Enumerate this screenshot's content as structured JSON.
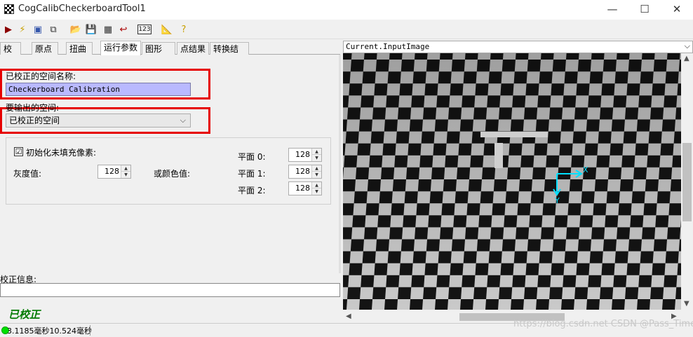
{
  "window": {
    "title": "CogCalibCheckerboardTool1",
    "minimize": "—",
    "maximize": "☐",
    "close": "✕"
  },
  "toolbar": {
    "items": [
      {
        "name": "run-icon",
        "glyph": "▶",
        "color": "#8b0000"
      },
      {
        "name": "electric-icon",
        "glyph": "⚡",
        "color": "#c8a000"
      },
      {
        "name": "display-icon",
        "glyph": "▣",
        "color": "#3355aa"
      },
      {
        "name": "image-source-icon",
        "glyph": "⧉",
        "color": "#333333"
      },
      {
        "name": "open-folder-icon",
        "glyph": "📂",
        "color": "#c8a000"
      },
      {
        "name": "save-icon",
        "glyph": "💾",
        "color": "#222222"
      },
      {
        "name": "grid-icon",
        "glyph": "▦",
        "color": "#333333"
      },
      {
        "name": "reset-icon",
        "glyph": "↩",
        "color": "#aa0000"
      },
      {
        "name": "numeric-icon",
        "glyph": "123",
        "color": "#222222"
      },
      {
        "name": "measure-icon",
        "glyph": "📐",
        "color": "#886600"
      },
      {
        "name": "help-icon",
        "glyph": "?",
        "color": "#c8a000"
      }
    ]
  },
  "tabs": [
    "校正",
    "原点",
    "扭曲",
    "运行参数",
    "图形",
    "点结果",
    "转换结果"
  ],
  "params": {
    "calibrated_space_label": "已校正的空间名称:",
    "calibrated_space_value": "Checkerboard Calibration",
    "output_space_label": "要输出的空间:",
    "output_space_value": "已校正的空间",
    "init_fill_label": "初始化未填充像素:",
    "init_fill_checked": "☑",
    "gray_label": "灰度值:",
    "gray_value": "128",
    "color_label": "或颜色值:",
    "plane0_label": "平面 0:",
    "plane0_value": "128",
    "plane1_label": "平面 1:",
    "plane1_value": "128",
    "plane2_label": "平面 2:",
    "plane2_value": "128"
  },
  "info": {
    "label": "校正信息:",
    "value": "",
    "status": "已校正"
  },
  "statusbar": {
    "time_text": "3.1185毫秒10.524毫秒",
    "status_color": "#00e000"
  },
  "view": {
    "title": "Current.InputImage",
    "axis_x": "X",
    "axis_y": "Y"
  },
  "watermark": "https://blog.csdn.net CSDN @Pass_Time_"
}
